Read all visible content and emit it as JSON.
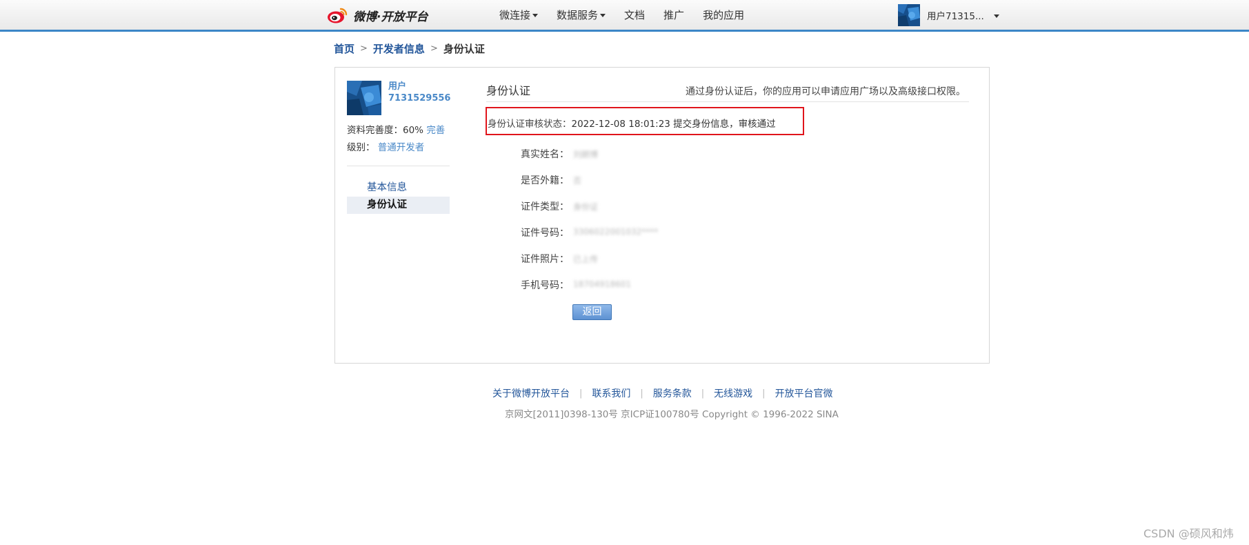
{
  "header": {
    "logo_text": "微博·开放平台",
    "nav": [
      {
        "label": "微连接",
        "has_dropdown": true
      },
      {
        "label": "数据服务",
        "has_dropdown": true
      },
      {
        "label": "文档",
        "has_dropdown": false
      },
      {
        "label": "推广",
        "has_dropdown": false
      },
      {
        "label": "我的应用",
        "has_dropdown": false
      }
    ],
    "user_name": "用户71315...",
    "accent_color": "#3b86c7"
  },
  "breadcrumb": {
    "items": [
      "首页",
      "开发者信息"
    ],
    "current": "身份认证"
  },
  "sidebar": {
    "username_line1": "用户",
    "username_line2": "7131529556",
    "completeness_label": "资料完善度：60%",
    "completeness_link": "完善",
    "level_label": "级别：",
    "level_value": "普通开发者",
    "menu": [
      {
        "label": "基本信息",
        "active": false
      },
      {
        "label": "身份认证",
        "active": true
      }
    ]
  },
  "content": {
    "title": "身份认证",
    "hint": "通过身份认证后，你的应用可以申请应用广场以及高级接口权限。",
    "status_label": "身份认证审核状态：",
    "status_value": "2022-12-08 18:01:23 提交身份信息，审核通过",
    "highlight_color": "#e0141b",
    "fields": [
      {
        "label": "真实姓名：",
        "value": "刘朗博"
      },
      {
        "label": "是否外籍：",
        "value": "否"
      },
      {
        "label": "证件类型：",
        "value": "身份证"
      },
      {
        "label": "证件号码：",
        "value": "3306022001032****"
      },
      {
        "label": "证件照片：",
        "value": "已上传"
      },
      {
        "label": "手机号码：",
        "value": "18704918601"
      }
    ],
    "back_button": "返回"
  },
  "footer": {
    "links": [
      "关于微博开放平台",
      "联系我们",
      "服务条款",
      "无线游戏",
      "开放平台官微"
    ],
    "separator": "|",
    "copyright": "京网文[2011]0398-130号 京ICP证100780号 Copyright © 1996-2022 SINA"
  },
  "watermark": "CSDN @硕风和炜"
}
